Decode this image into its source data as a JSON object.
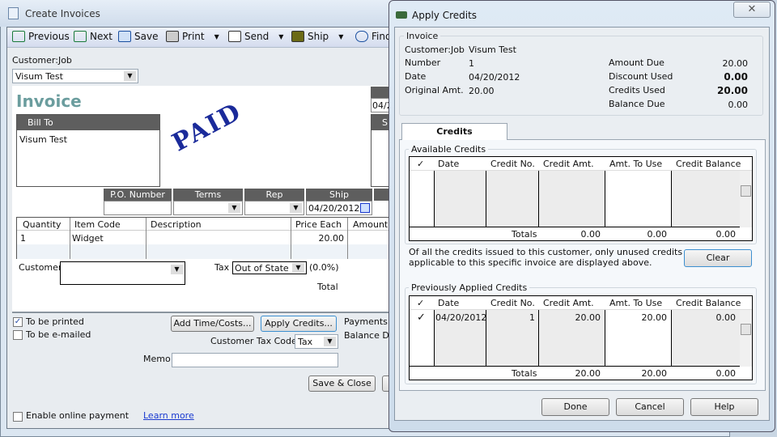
{
  "invoice_window": {
    "title": "Create Invoices",
    "toolbar": {
      "previous": "Previous",
      "next": "Next",
      "save": "Save",
      "print": "Print",
      "send": "Send",
      "ship": "Ship",
      "find": "Find"
    },
    "customer_job_label": "Customer:Job",
    "customer_job_value": "Visum Test",
    "form_title": "Invoice",
    "stamp": "PAID",
    "bill_to_label": "Bill To",
    "bill_to_value": "Visum Test",
    "date_partial": "04/2",
    "ship_to_partial": "Sh",
    "po_number_label": "P.O. Number",
    "terms_label": "Terms",
    "rep_label": "Rep",
    "ship_label": "Ship",
    "ship_date": "04/20/2012",
    "line_columns": [
      "Quantity",
      "Item Code",
      "Description",
      "Price Each",
      "Amount"
    ],
    "line_items": [
      {
        "quantity": "1",
        "item_code": "Widget",
        "description": "",
        "price_each": "20.00",
        "amount": ""
      }
    ],
    "customer_message_label": "Customer Message",
    "tax_label": "Tax",
    "tax_value": "Out of State",
    "tax_rate": "(0.0%)",
    "total_label": "Total",
    "to_be_printed": {
      "label": "To be printed",
      "checked": true
    },
    "to_be_emailed": {
      "label": "To be e-mailed",
      "checked": false
    },
    "add_time_costs": "Add Time/Costs...",
    "apply_credits": "Apply Credits...",
    "payments_applied_partial": "Payments A",
    "balance_due_partial": "Balance Due",
    "customer_tax_code_label": "Customer Tax Code",
    "customer_tax_code_value": "Tax",
    "memo_label": "Memo",
    "memo_value": "",
    "save_close": "Save & Close",
    "enable_online_payment": {
      "label": "Enable online payment",
      "checked": false
    },
    "learn_more": "Learn more"
  },
  "apply_credits": {
    "title": "Apply Credits",
    "invoice_group": "Invoice",
    "customer_job_label": "Customer:Job",
    "customer_job": "Visum Test",
    "number_label": "Number",
    "number": "1",
    "date_label": "Date",
    "date": "04/20/2012",
    "original_amt_label": "Original Amt.",
    "original_amt": "20.00",
    "amount_due_label": "Amount Due",
    "amount_due": "20.00",
    "discount_used_label": "Discount Used",
    "discount_used": "0.00",
    "credits_used_label": "Credits Used",
    "credits_used": "20.00",
    "balance_due_label": "Balance Due",
    "balance_due": "0.00",
    "tab": "Credits",
    "columns": [
      "✓",
      "Date",
      "Credit No.",
      "Credit Amt.",
      "Amt. To Use",
      "Credit Balance"
    ],
    "available": {
      "label": "Available Credits",
      "totals_label": "Totals",
      "totals": [
        "0.00",
        "0.00",
        "0.00"
      ]
    },
    "note": [
      "Of all the credits issued to this customer, only unused credits",
      "applicable to this specific invoice are displayed above."
    ],
    "clear": "Clear",
    "previous": {
      "label": "Previously Applied Credits",
      "rows": [
        {
          "check": "✓",
          "date": "04/20/2012",
          "credit_no": "1",
          "credit_amt": "20.00",
          "amt_to_use": "20.00",
          "credit_balance": "0.00"
        }
      ],
      "totals_label": "Totals",
      "totals": [
        "20.00",
        "20.00",
        "0.00"
      ]
    },
    "done": "Done",
    "cancel": "Cancel",
    "help": "Help"
  }
}
